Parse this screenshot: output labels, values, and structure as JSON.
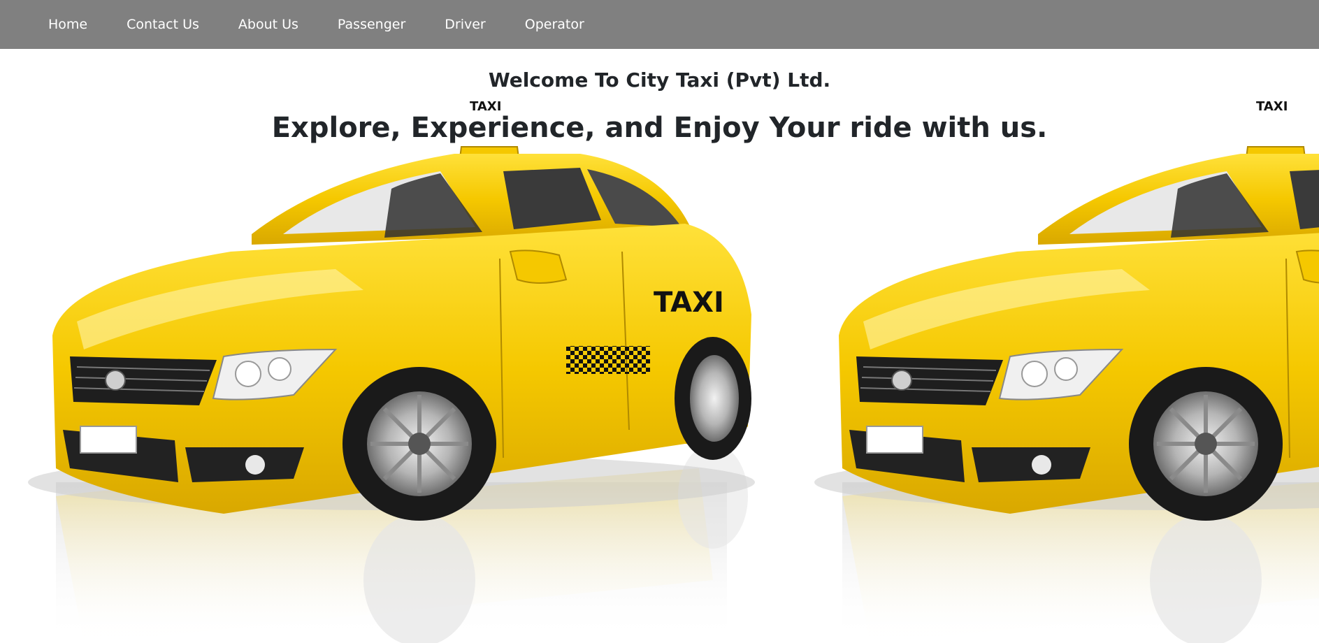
{
  "nav": {
    "items": [
      {
        "label": "Home"
      },
      {
        "label": "Contact Us"
      },
      {
        "label": "About Us"
      },
      {
        "label": "Passenger"
      },
      {
        "label": "Driver"
      },
      {
        "label": "Operator"
      }
    ]
  },
  "hero": {
    "welcome": "Welcome To City Taxi (Pvt) Ltd.",
    "tagline": "Explore, Experience, and Enjoy Your ride with us.",
    "car_badge_text": "TAXI",
    "roof_sign_text": "TAXI"
  },
  "colors": {
    "navbar_bg": "#808080",
    "nav_text": "#ffffff",
    "heading_text": "#212529",
    "taxi_yellow": "#f5c800"
  }
}
